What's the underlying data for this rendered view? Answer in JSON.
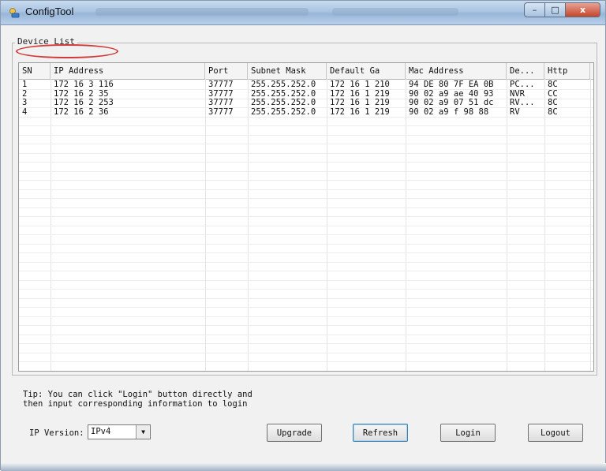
{
  "window": {
    "title": "ConfigTool",
    "minimize": "–",
    "maximize": "□",
    "close": "x"
  },
  "device_list": {
    "legend": "Device List",
    "columns": [
      "SN",
      "IP Address",
      "Port",
      "Subnet Mask",
      "Default Ga",
      "Mac Address",
      "De...",
      "Http"
    ],
    "rows": [
      [
        "1",
        "172 16 3 116",
        "37777",
        "255.255.252.0",
        "172 16 1 210",
        "94 DE 80 7F EA 0B",
        "PC...",
        "8C"
      ],
      [
        "2",
        "172 16 2 35",
        "37777",
        "255.255.252.0",
        "172 16 1 219",
        "90 02 a9 ae 40 93",
        "NVR",
        "CC"
      ],
      [
        "3",
        "172 16 2 253",
        "37777",
        "255.255.252.0",
        "172 16 1 219",
        "90 02 a9 07 51 dc",
        "RV...",
        "8C"
      ],
      [
        "4",
        "172 16 2 36",
        "37777",
        "255.255.252.0",
        "172 16 1 219",
        "90 02 a9 f 98 88",
        "RV",
        "8C"
      ]
    ]
  },
  "tip": {
    "line1": "Tip: You can click \"Login\" button directly and",
    "line2": "then input corresponding information to login"
  },
  "ip_version": {
    "label": "IP Version:",
    "selected": "IPv4"
  },
  "buttons": {
    "upgrade": "Upgrade",
    "refresh": "Refresh",
    "login": "Login",
    "logout": "Logout"
  },
  "colors": {
    "highlight_oval": "#d23a3a",
    "focus_border": "#3c7fb1"
  }
}
